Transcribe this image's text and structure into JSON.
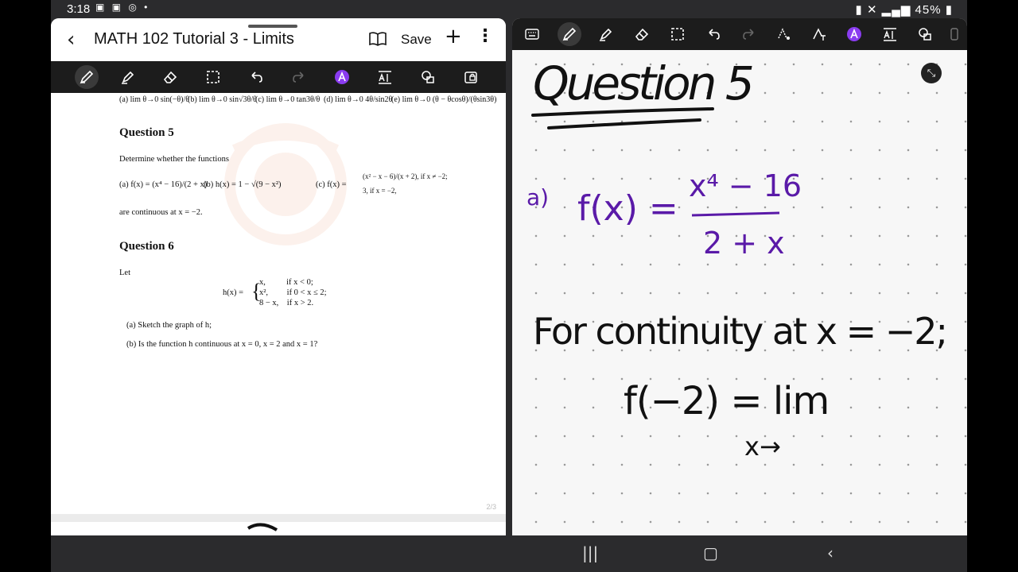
{
  "status": {
    "time": "3:18",
    "battery": "45%"
  },
  "left": {
    "title": "MATH 102 Tutorial 3 - Limits",
    "save_label": "Save",
    "limits_row": [
      "(a) lim θ→0 sin(−θ)/θ",
      "(b) lim θ→0 sin√3θ/θ",
      "(c) lim θ→0 tan3θ/θ",
      "(d) lim θ→0 4θ/sin2θ",
      "(e) lim θ→0 (θ − θcosθ)/(θsin3θ)"
    ],
    "q5": {
      "heading": "Question 5",
      "intro": "Determine whether the functions",
      "a": "(a) f(x) = (x⁴ − 16)/(2 + x)",
      "b": "(b) h(x) = 1 − √(9 − x²)",
      "c_label": "(c) f(x) =",
      "c_case1": "(x² − x − 6)/(x + 2),   if x ≠ −2;",
      "c_case2": "3,                       if x = −2,",
      "outro": "are continuous at x = −2."
    },
    "q6": {
      "heading": "Question 6",
      "let": "Let",
      "h_label": "h(x) =",
      "cases": [
        "x,          if x < 0;",
        "x²,         if 0 < x ≤ 2;",
        "8 − x,    if x > 2."
      ],
      "part_a": "(a)  Sketch the graph of h;",
      "part_b": "(b)  Is the function h continuous at x = 0, x = 2 and x = 1?"
    },
    "page_indicator": "2/3"
  },
  "notes": {
    "heading": "Question 5",
    "part_label": "a)",
    "lhs": "f(x) =",
    "numerator": "x⁴ − 16",
    "denominator": "2 + x",
    "line1": "For continuity at x = −2;",
    "line2": "f(−2) = lim",
    "line3": "x→"
  },
  "colors": {
    "ink_black": "#111111",
    "ink_purple": "#5a1aa8",
    "toolbar": "#1c1c1c"
  }
}
